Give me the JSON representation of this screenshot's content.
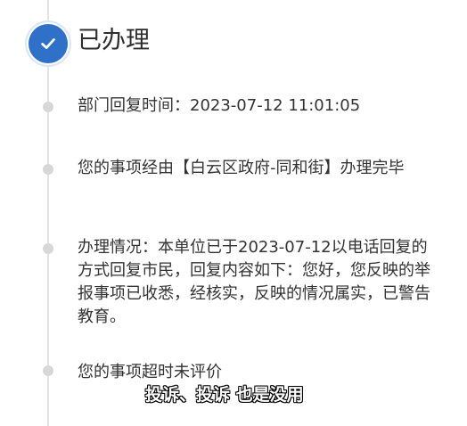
{
  "status": {
    "title": "已办理",
    "icon": "check-icon",
    "accent_color": "#2f70c8"
  },
  "timeline": {
    "reply_time_label": "部门回复时间：",
    "reply_time_value": "2023-07-12 11:01:05",
    "handled_by_text": "您的事项经由【白云区政府-同和街】办理完毕",
    "handling_details_text": "办理情况：本单位已于2023-07-12以电话回复的方式回复市民，回复内容如下：您好，您反映的举报事项已收悉，经核实，反映的情况属实，已警告教育。",
    "evaluation_text": "您的事项超时未评价"
  },
  "caption": {
    "text": "投诉、投诉 也是没用"
  }
}
